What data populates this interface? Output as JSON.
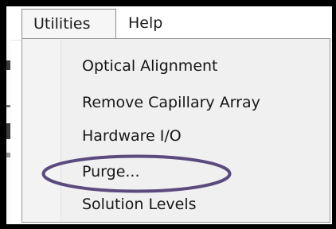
{
  "menubar": {
    "items": [
      {
        "label": "Utilities",
        "active": true
      },
      {
        "label": "Help",
        "active": false
      }
    ]
  },
  "dropdown": {
    "items": [
      {
        "label": "Optical Alignment"
      },
      {
        "label": "Remove Capillary Array"
      },
      {
        "label": "Hardware I/O"
      },
      {
        "label": "Purge..."
      },
      {
        "label": "Solution Levels",
        "highlighted": true
      }
    ]
  },
  "colors": {
    "highlight_ellipse": "#5b4a7e",
    "frame_background": "#000000",
    "menu_background": "#f0f0f0"
  }
}
